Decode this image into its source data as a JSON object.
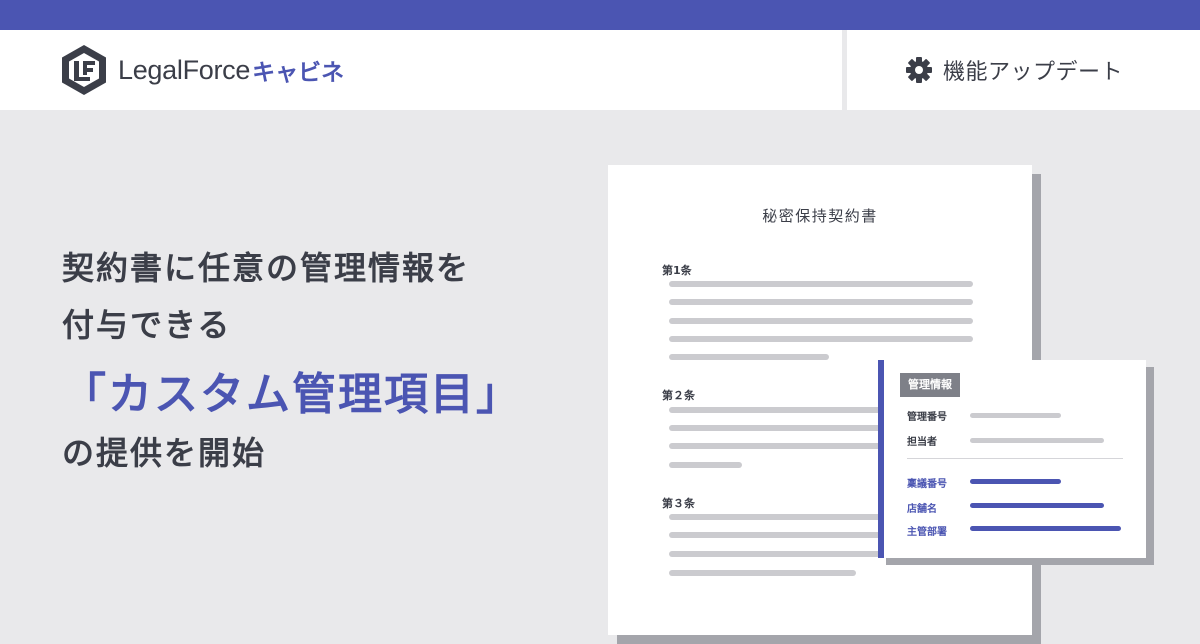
{
  "colors": {
    "brand": "#4b55b2",
    "text": "#3b3e48",
    "background": "#e9e9eb",
    "placeholder_line": "#cbcbcf"
  },
  "header": {
    "logo_word": "LegalForce",
    "logo_kana": "キャビネ",
    "update_icon": "gear-icon",
    "update_label": "機能アップデート"
  },
  "headline": {
    "line1": "契約書に任意の管理情報を",
    "line2": "付与できる",
    "line3": "「カスタム管理項目」",
    "line4": "の提供を開始"
  },
  "document": {
    "title": "秘密保持契約書",
    "articles": [
      "第1条",
      "第２条",
      "第３条"
    ]
  },
  "info_card": {
    "tag": "管理情報",
    "standard_fields": [
      "管理番号",
      "担当者"
    ],
    "custom_fields": [
      "稟議番号",
      "店舗名",
      "主管部署"
    ]
  }
}
